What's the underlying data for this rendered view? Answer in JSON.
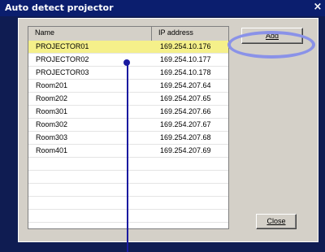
{
  "window": {
    "title": "Auto detect projector",
    "close_glyph": "×"
  },
  "list": {
    "columns": [
      "Name",
      "IP address"
    ],
    "rows": [
      {
        "name": "PROJECTOR01",
        "ip": "169.254.10.176",
        "selected": true
      },
      {
        "name": "PROJECTOR02",
        "ip": "169.254.10.177"
      },
      {
        "name": "PROJECTOR03",
        "ip": "169.254.10.178"
      },
      {
        "name": "Room201",
        "ip": "169.254.207.64"
      },
      {
        "name": "Room202",
        "ip": "169.254.207.65"
      },
      {
        "name": "Room301",
        "ip": "169.254.207.66"
      },
      {
        "name": "Room302",
        "ip": "169.254.207.67"
      },
      {
        "name": "Room303",
        "ip": "169.254.207.68"
      },
      {
        "name": "Room401",
        "ip": "169.254.207.69"
      }
    ]
  },
  "buttons": {
    "add": "Add",
    "close": "Close"
  },
  "colors": {
    "selected_row": "#f5f08a",
    "highlight_ring": "#8a92e8",
    "pointer": "#1a1aa0"
  }
}
